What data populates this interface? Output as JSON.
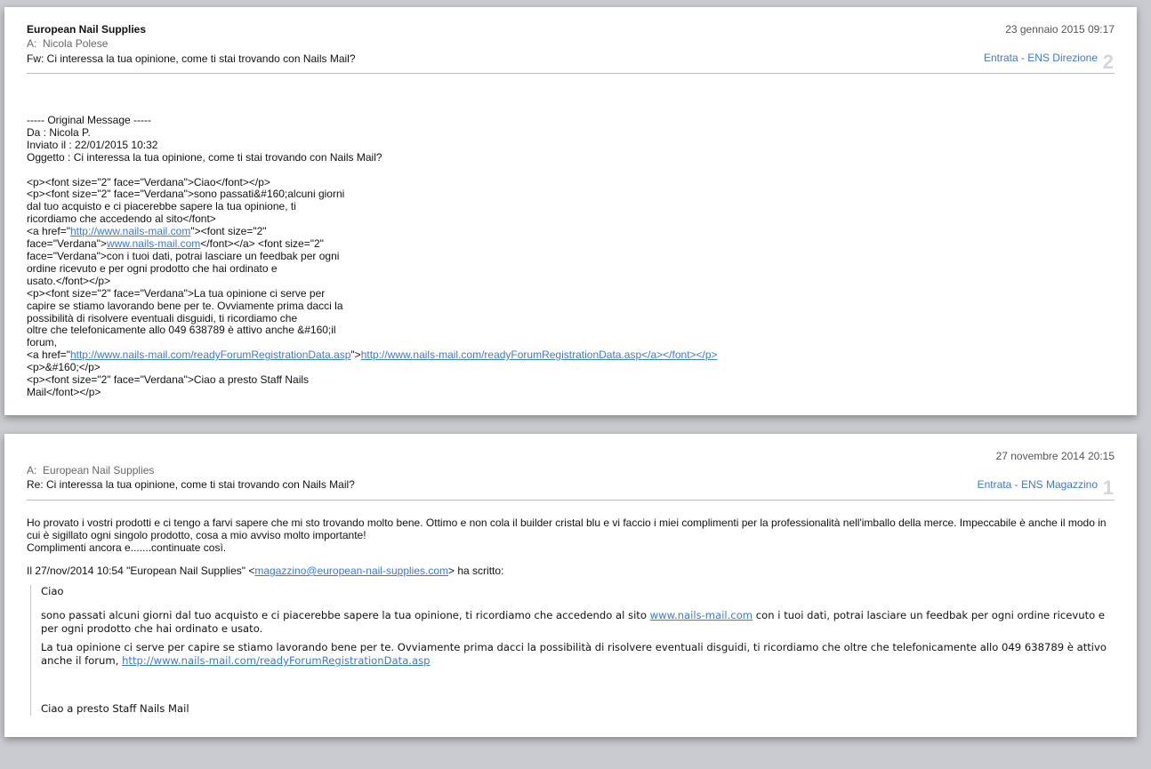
{
  "messages": [
    {
      "from": "European Nail Supplies",
      "to_prefix": "A:",
      "to": "Nicola Polese",
      "subject": "Fw: Ci interessa la tua opinione, come ti stai trovando con Nails Mail?",
      "date": "23 gennaio 2015 09:17",
      "mailbox": "Entrata - ENS Direzione",
      "number": "2",
      "body_lines": [
        "----- Original Message -----",
        "Da : Nicola P.",
        "Inviato il : 22/01/2015 10:32",
        "Oggetto : Ci interessa la tua opinione, come ti stai trovando con Nails Mail?",
        "",
        "<p><font size=\"2\" face=\"Verdana\">Ciao</font></p>",
        "<p><font size=\"2\" face=\"Verdana\">sono passati&#160;alcuni giorni",
        "dal tuo acquisto e ci piacerebbe sapere la tua opinione, ti",
        "ricordiamo che accedendo al sito</font>"
      ],
      "link_line1_a": "<a href=\"",
      "link_line1_url": "http://www.nails-mail.com",
      "link_line1_b": "\"><font size=\"2\"",
      "link_line2_a": "face=\"Verdana\">",
      "link_line2_url": "www.nails-mail.com",
      "link_line2_b": "</font></a> <font size=\"2\"",
      "body_lines_2": [
        "face=\"Verdana\">con i tuoi dati, potrai lasciare un feedbak per ogni",
        "ordine ricevuto e per ogni prodotto che hai ordinato e",
        "usato.</font></p>",
        "<p><font size=\"2\" face=\"Verdana\">La tua opinione ci serve per",
        "capire se stiamo lavorando bene per te. Ovviamente prima dacci la",
        "possibilità di risolvere eventuali disguidi, ti ricordiamo che",
        "oltre che telefonicamente allo 049 638789 è attivo anche &#160;il",
        "forum,"
      ],
      "link_line3_a": "<a href=\"",
      "link_line3_url": "http://www.nails-mail.com/readyForumRegistrationData.asp",
      "link_line3_b": "\">",
      "link_line3_url2": "http://www.nails-mail.com/readyForumRegistrationData.asp</a></font></p>",
      "body_lines_3": [
        "<p>&#160;</p>",
        "<p><font size=\"2\" face=\"Verdana\">Ciao a presto Staff Nails",
        "Mail</font></p>"
      ]
    },
    {
      "to_prefix": "A:",
      "to": "European Nail Supplies",
      "subject": "Re: Ci interessa la tua opinione, come ti stai trovando con Nails Mail?",
      "date": "27 novembre 2014 20:15",
      "mailbox": "Entrata - ENS Magazzino",
      "number": "1",
      "body_p1": "Ho provato i vostri prodotti e ci tengo a farvi sapere che mi sto trovando molto bene. Ottimo e non cola il builder cristal blu e vi faccio i miei complimenti per la professionalità nell'imballo  della merce. Impeccabile è anche il modo in cui è sigillato ogni singolo prodotto, cosa a mio avviso molto importante!",
      "body_p2": "Complimenti ancora e.......continuate così.",
      "reply_header_a": "Il 27/nov/2014 10:54 \"European Nail Supplies\" <",
      "reply_header_email": "magazzino@european-nail-supplies.com",
      "reply_header_b": "> ha scritto:",
      "quote_p1": "Ciao",
      "quote_p2_a": "sono passati alcuni giorni dal tuo acquisto e ci piacerebbe sapere la tua opinione, ti ricordiamo che accedendo al sito ",
      "quote_p2_link": "www.nails-mail.com",
      "quote_p2_b": " con i tuoi dati, potrai lasciare un feedbak per ogni ordine ricevuto e per ogni prodotto che hai ordinato e usato.",
      "quote_p3_a": "La tua opinione ci serve per capire se stiamo lavorando bene per te. Ovviamente prima dacci la possibilità di risolvere eventuali disguidi, ti ricordiamo che oltre che telefonicamente allo 049 638789 è attivo anche  il forum, ",
      "quote_p3_link": "http://www.nails-mail.com/readyForumRegistrationData.asp",
      "quote_p4": "Ciao a presto Staff Nails Mail"
    }
  ]
}
